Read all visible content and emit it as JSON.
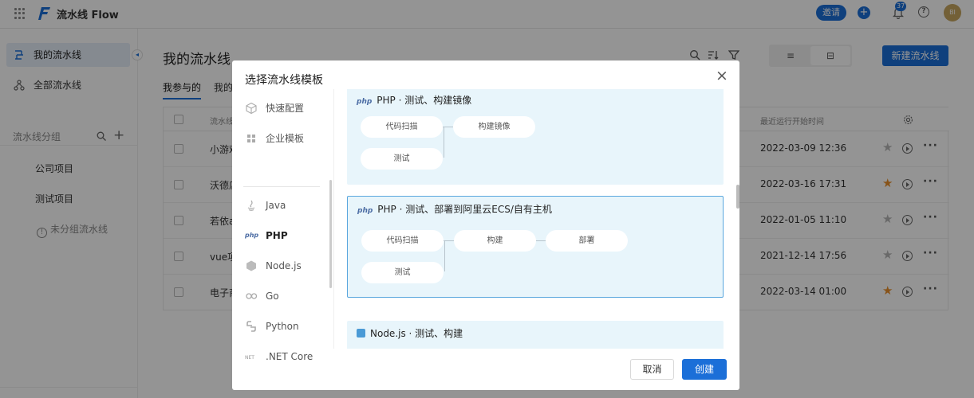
{
  "app": {
    "title": "流水线 Flow",
    "invite": "邀请",
    "notif_count": "37",
    "help": "?",
    "avatar": "BI"
  },
  "sidebar": {
    "items": [
      {
        "label": "我的流水线"
      },
      {
        "label": "全部流水线"
      }
    ],
    "group_title": "流水线分组",
    "groups": [
      {
        "label": "公司项目"
      },
      {
        "label": "测试项目"
      }
    ],
    "ungrouped": "未分组流水线"
  },
  "main": {
    "title": "我的流水线",
    "tabs": [
      {
        "label": "我参与的"
      },
      {
        "label": "我的"
      }
    ],
    "new_button": "新建流水线",
    "view_list": "≡",
    "view_card": "⊟",
    "columns": {
      "name": "流水线",
      "time": "最近运行开始时间"
    },
    "rows": [
      {
        "name": "小游戏",
        "time": "2022-03-09 12:36",
        "starred": false
      },
      {
        "name": "沃德店",
        "time": "2022-03-16 17:31",
        "starred": true
      },
      {
        "name": "若依ad",
        "time": "2022-01-05 11:10",
        "starred": false
      },
      {
        "name": "vue项目",
        "time": "2021-12-14 17:56",
        "starred": false
      },
      {
        "name": "电子商",
        "time": "2022-03-14 01:00",
        "starred": true
      }
    ]
  },
  "modal": {
    "title": "选择流水线模板",
    "close": "×",
    "nav": [
      {
        "label": "快速配置",
        "icon": "cube-icon"
      },
      {
        "label": "企业模板",
        "icon": "grid-icon"
      },
      {
        "label": "Java",
        "icon": "java-icon"
      },
      {
        "label": "PHP",
        "icon": "php-icon"
      },
      {
        "label": "Node.js",
        "icon": "nodejs-icon"
      },
      {
        "label": "Go",
        "icon": "go-icon"
      },
      {
        "label": "Python",
        "icon": "python-icon"
      },
      {
        "label": ".NET Core",
        "icon": "dotnet-icon"
      }
    ],
    "php_logo": "php",
    "templates": [
      {
        "title": "PHP · 测试、构建镜像",
        "steps": [
          "代码扫描",
          "构建镜像",
          "测试"
        ]
      },
      {
        "title": "PHP · 测试、部署到阿里云ECS/自有主机",
        "steps": [
          "代码扫描",
          "构建",
          "部署",
          "测试"
        ]
      },
      {
        "title": "Node.js · 测试、构建"
      }
    ],
    "cancel": "取消",
    "create": "创建"
  },
  "colors": {
    "accent": "#1b6fd8",
    "star": "#e8902c",
    "card_bg": "#e8f5fb"
  }
}
